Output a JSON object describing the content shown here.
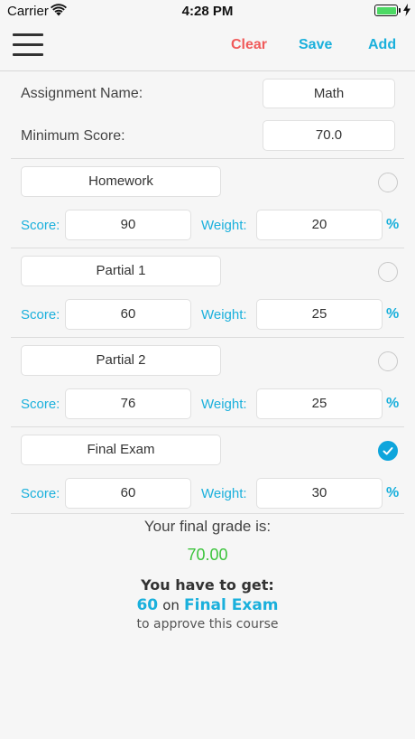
{
  "status_bar": {
    "carrier": "Carrier",
    "time": "4:28 PM",
    "battery_level": 1.0
  },
  "nav": {
    "clear_label": "Clear",
    "save_label": "Save",
    "add_label": "Add",
    "menu_icon": "hamburger-menu-icon"
  },
  "form": {
    "assignment_label": "Assignment Name:",
    "assignment_value": "Math",
    "min_score_label": "Minimum Score:",
    "min_score_value": "70.0"
  },
  "labels": {
    "score": "Score:",
    "weight": "Weight:",
    "percent": "%"
  },
  "items": [
    {
      "name": "Homework",
      "score": "90",
      "weight": "20",
      "selected": false
    },
    {
      "name": "Partial 1",
      "score": "60",
      "weight": "25",
      "selected": false
    },
    {
      "name": "Partial 2",
      "score": "76",
      "weight": "25",
      "selected": false
    },
    {
      "name": "Final Exam",
      "score": "60",
      "weight": "30",
      "selected": true
    }
  ],
  "result": {
    "title": "Your final grade is:",
    "grade": "70.00",
    "line1": "You have to get:",
    "needed_score": "60",
    "on_word": "on",
    "target_item": "Final Exam",
    "line3": "to approve this course"
  },
  "colors": {
    "accent": "#1ab0dc",
    "clear": "#f05a5a",
    "grade": "#3cc43c",
    "battery": "#4cd964"
  }
}
